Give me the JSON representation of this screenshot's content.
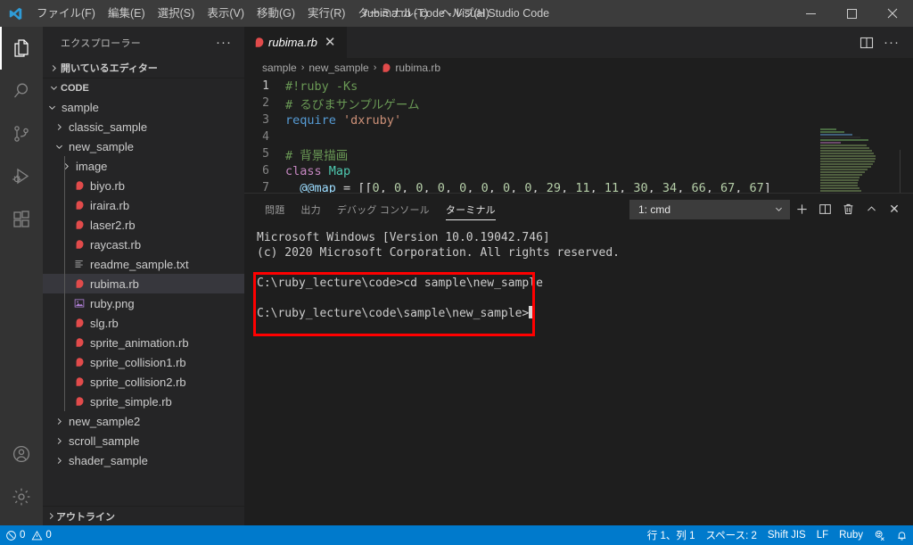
{
  "titlebar": {
    "logo_icon": "vscode-logo-icon",
    "window_title": "rubima.rb - code - Visual Studio Code",
    "menu": [
      {
        "label": "ファイル(F)",
        "name": "menu-file"
      },
      {
        "label": "編集(E)",
        "name": "menu-edit"
      },
      {
        "label": "選択(S)",
        "name": "menu-selection"
      },
      {
        "label": "表示(V)",
        "name": "menu-view"
      },
      {
        "label": "移動(G)",
        "name": "menu-go"
      },
      {
        "label": "実行(R)",
        "name": "menu-run"
      },
      {
        "label": "ターミナル(T)",
        "name": "menu-terminal"
      },
      {
        "label": "ヘルプ(H)",
        "name": "menu-help"
      }
    ],
    "minimize": "—",
    "maximize": "□",
    "close": "✕"
  },
  "activitybar": {
    "items": [
      {
        "icon": "explorer-icon",
        "active": true
      },
      {
        "icon": "search-icon",
        "active": false
      },
      {
        "icon": "source-control-icon",
        "active": false
      },
      {
        "icon": "run-and-debug-icon",
        "active": false
      },
      {
        "icon": "extensions-icon",
        "active": false
      }
    ],
    "bottom": [
      {
        "icon": "accounts-icon"
      },
      {
        "icon": "settings-gear-icon"
      }
    ]
  },
  "sidebar": {
    "title": "エクスプローラー",
    "more_actions": "···",
    "open_editors_label": "開いているエディター",
    "root_folder_label": "CODE",
    "outline_label": "アウトライン",
    "tree": [
      {
        "label": "sample",
        "type": "folder",
        "expanded": true,
        "indent": 1,
        "selected": false
      },
      {
        "label": "classic_sample",
        "type": "folder",
        "expanded": false,
        "indent": 2,
        "selected": false
      },
      {
        "label": "new_sample",
        "type": "folder",
        "expanded": true,
        "indent": 2,
        "selected": false
      },
      {
        "label": "image",
        "type": "folder",
        "expanded": false,
        "indent": 3,
        "selected": false
      },
      {
        "label": "biyo.rb",
        "type": "ruby",
        "indent": 3,
        "selected": false
      },
      {
        "label": "iraira.rb",
        "type": "ruby",
        "indent": 3,
        "selected": false
      },
      {
        "label": "laser2.rb",
        "type": "ruby",
        "indent": 3,
        "selected": false
      },
      {
        "label": "raycast.rb",
        "type": "ruby",
        "indent": 3,
        "selected": false
      },
      {
        "label": "readme_sample.txt",
        "type": "text",
        "indent": 3,
        "selected": false
      },
      {
        "label": "rubima.rb",
        "type": "ruby",
        "indent": 3,
        "selected": true
      },
      {
        "label": "ruby.png",
        "type": "image",
        "indent": 3,
        "selected": false
      },
      {
        "label": "slg.rb",
        "type": "ruby",
        "indent": 3,
        "selected": false
      },
      {
        "label": "sprite_animation.rb",
        "type": "ruby",
        "indent": 3,
        "selected": false
      },
      {
        "label": "sprite_collision1.rb",
        "type": "ruby",
        "indent": 3,
        "selected": false
      },
      {
        "label": "sprite_collision2.rb",
        "type": "ruby",
        "indent": 3,
        "selected": false
      },
      {
        "label": "sprite_simple.rb",
        "type": "ruby",
        "indent": 3,
        "selected": false
      },
      {
        "label": "new_sample2",
        "type": "folder",
        "expanded": false,
        "indent": 2,
        "selected": false
      },
      {
        "label": "scroll_sample",
        "type": "folder",
        "expanded": false,
        "indent": 2,
        "selected": false
      },
      {
        "label": "shader_sample",
        "type": "folder",
        "expanded": false,
        "indent": 2,
        "selected": false
      }
    ]
  },
  "editor": {
    "tab": {
      "label": "rubima.rb",
      "icon": "ruby-file-icon",
      "close": "✕"
    },
    "actions": {
      "split_icon": "split-editor-icon",
      "more_icon": "more-actions-icon",
      "more_label": "···"
    },
    "breadcrumbs": [
      "sample",
      "new_sample",
      "rubima.rb"
    ],
    "breadcrumb_separator": "›",
    "lines": [
      {
        "no": "1",
        "tokens": [
          {
            "t": "#!ruby -Ks",
            "c": "tok-comment"
          }
        ]
      },
      {
        "no": "2",
        "tokens": [
          {
            "t": "# るびまサンプルゲーム",
            "c": "tok-comment"
          }
        ]
      },
      {
        "no": "3",
        "tokens": [
          {
            "t": "require",
            "c": "tok-kw"
          },
          {
            "t": " ",
            "c": "tok-plain"
          },
          {
            "t": "'dxruby'",
            "c": "tok-str"
          }
        ]
      },
      {
        "no": "4",
        "tokens": [
          {
            "t": "",
            "c": "tok-plain"
          }
        ]
      },
      {
        "no": "5",
        "tokens": [
          {
            "t": "# 背景描画",
            "c": "tok-comment"
          }
        ]
      },
      {
        "no": "6",
        "tokens": [
          {
            "t": "class",
            "c": "tok-class"
          },
          {
            "t": " ",
            "c": "tok-plain"
          },
          {
            "t": "Map",
            "c": "tok-type"
          }
        ]
      },
      {
        "no": "7",
        "tokens": [
          {
            "t": "  ",
            "c": "tok-plain"
          },
          {
            "t": "@@map",
            "c": "tok-var"
          },
          {
            "t": " = [[",
            "c": "tok-plain"
          },
          {
            "t": "0",
            "c": "tok-num"
          },
          {
            "t": ", ",
            "c": "tok-plain"
          },
          {
            "t": "0",
            "c": "tok-num"
          },
          {
            "t": ", ",
            "c": "tok-plain"
          },
          {
            "t": "0",
            "c": "tok-num"
          },
          {
            "t": ", ",
            "c": "tok-plain"
          },
          {
            "t": "0",
            "c": "tok-num"
          },
          {
            "t": ", ",
            "c": "tok-plain"
          },
          {
            "t": "0",
            "c": "tok-num"
          },
          {
            "t": ", ",
            "c": "tok-plain"
          },
          {
            "t": "0",
            "c": "tok-num"
          },
          {
            "t": ", ",
            "c": "tok-plain"
          },
          {
            "t": "0",
            "c": "tok-num"
          },
          {
            "t": ", ",
            "c": "tok-plain"
          },
          {
            "t": "0",
            "c": "tok-num"
          },
          {
            "t": ", ",
            "c": "tok-plain"
          },
          {
            "t": "29",
            "c": "tok-num"
          },
          {
            "t": ", ",
            "c": "tok-plain"
          },
          {
            "t": "11",
            "c": "tok-num"
          },
          {
            "t": ", ",
            "c": "tok-plain"
          },
          {
            "t": "11",
            "c": "tok-num"
          },
          {
            "t": ", ",
            "c": "tok-plain"
          },
          {
            "t": "30",
            "c": "tok-num"
          },
          {
            "t": ", ",
            "c": "tok-plain"
          },
          {
            "t": "34",
            "c": "tok-num"
          },
          {
            "t": ", ",
            "c": "tok-plain"
          },
          {
            "t": "66",
            "c": "tok-num"
          },
          {
            "t": ", ",
            "c": "tok-plain"
          },
          {
            "t": "67",
            "c": "tok-num"
          },
          {
            "t": ", ",
            "c": "tok-plain"
          },
          {
            "t": "67",
            "c": "tok-num"
          },
          {
            "t": "]",
            "c": "tok-plain"
          }
        ]
      }
    ]
  },
  "panel": {
    "tabs": [
      {
        "label": "問題",
        "active": false,
        "name": "panel-tab-problems"
      },
      {
        "label": "出力",
        "active": false,
        "name": "panel-tab-output"
      },
      {
        "label": "デバッグ コンソール",
        "active": false,
        "name": "panel-tab-debug-console"
      },
      {
        "label": "ターミナル",
        "active": true,
        "name": "panel-tab-terminal"
      }
    ],
    "terminal_select": {
      "value": "1: cmd",
      "chevron": "⌄"
    },
    "actions": {
      "new_terminal": "+",
      "split_terminal": "split-terminal-icon",
      "kill_terminal": "trash-icon",
      "maximize_panel": "chevron-up-icon",
      "close_panel": "✕"
    },
    "terminal_lines": [
      "Microsoft Windows [Version 10.0.19042.746]",
      "(c) 2020 Microsoft Corporation. All rights reserved.",
      "",
      "C:\\ruby_lecture\\code>cd sample\\new_sample",
      "",
      "C:\\ruby_lecture\\code\\sample\\new_sample>"
    ],
    "highlight_color": "#ff0000"
  },
  "statusbar": {
    "errors": "0",
    "warnings": "0",
    "cursor_position": "行 1、列 1",
    "indentation": "スペース: 2",
    "encoding": "Shift JIS",
    "eol": "LF",
    "language": "Ruby",
    "feedback_icon": "smiley-feedback-icon",
    "bell_icon": "notifications-bell-icon",
    "background": "#007acc"
  }
}
